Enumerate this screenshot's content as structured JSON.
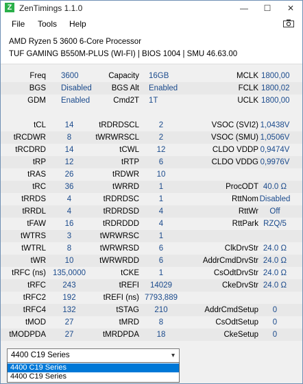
{
  "window": {
    "title": "ZenTimings 1.1.0",
    "icon_letter": "Z",
    "minimize": "—",
    "maximize": "☐",
    "close": "✕"
  },
  "menu": {
    "file": "File",
    "tools": "Tools",
    "help": "Help"
  },
  "header": {
    "cpu": "AMD Ryzen 5 3600 6-Core Processor",
    "board": "TUF GAMING B550M-PLUS (WI-FI) | BIOS 1004 | SMU 46.63.00"
  },
  "top_rows": [
    {
      "l1": "Freq",
      "v1": "3600",
      "l2": "Capacity",
      "v2": "16GB",
      "l3": "MCLK",
      "v3": "1800,00"
    },
    {
      "l1": "BGS",
      "v1": "Disabled",
      "l2": "BGS Alt",
      "v2": "Enabled",
      "l3": "FCLK",
      "v3": "1800,02"
    },
    {
      "l1": "GDM",
      "v1": "Enabled",
      "l2": "Cmd2T",
      "v2": "1T",
      "l3": "UCLK",
      "v3": "1800,00"
    }
  ],
  "rows": [
    {
      "l1": "tCL",
      "v1": "14",
      "l2": "tRDRDSCL",
      "v2": "2",
      "l3": "VSOC (SVI2)",
      "v3": "1,0438V"
    },
    {
      "l1": "tRCDWR",
      "v1": "8",
      "l2": "tWRWRSCL",
      "v2": "2",
      "l3": "VSOC (SMU)",
      "v3": "1,0506V"
    },
    {
      "l1": "tRCDRD",
      "v1": "14",
      "l2": "tCWL",
      "v2": "12",
      "l3": "CLDO VDDP",
      "v3": "0,9474V"
    },
    {
      "l1": "tRP",
      "v1": "12",
      "l2": "tRTP",
      "v2": "6",
      "l3": "CLDO VDDG",
      "v3": "0,9976V"
    },
    {
      "l1": "tRAS",
      "v1": "26",
      "l2": "tRDWR",
      "v2": "10",
      "l3": "",
      "v3": ""
    },
    {
      "l1": "tRC",
      "v1": "36",
      "l2": "tWRRD",
      "v2": "1",
      "l3": "ProcODT",
      "v3": "40.0 Ω"
    },
    {
      "l1": "tRRDS",
      "v1": "4",
      "l2": "tRDRDSC",
      "v2": "1",
      "l3": "RttNom",
      "v3": "Disabled"
    },
    {
      "l1": "tRRDL",
      "v1": "4",
      "l2": "tRDRDSD",
      "v2": "4",
      "l3": "RttWr",
      "v3": "Off"
    },
    {
      "l1": "tFAW",
      "v1": "16",
      "l2": "tRDRDDD",
      "v2": "4",
      "l3": "RttPark",
      "v3": "RZQ/5"
    },
    {
      "l1": "tWTRS",
      "v1": "3",
      "l2": "tWRWRSC",
      "v2": "1",
      "l3": "",
      "v3": ""
    },
    {
      "l1": "tWTRL",
      "v1": "8",
      "l2": "tWRWRSD",
      "v2": "6",
      "l3": "ClkDrvStr",
      "v3": "24.0 Ω"
    },
    {
      "l1": "tWR",
      "v1": "10",
      "l2": "tWRWRDD",
      "v2": "6",
      "l3": "AddrCmdDrvStr",
      "v3": "24.0 Ω"
    },
    {
      "l1": "tRFC (ns)",
      "v1": "135,0000",
      "l2": "tCKE",
      "v2": "1",
      "l3": "CsOdtDrvStr",
      "v3": "24.0 Ω"
    },
    {
      "l1": "tRFC",
      "v1": "243",
      "l2": "tREFI",
      "v2": "14029",
      "l3": "CkeDrvStr",
      "v3": "24.0 Ω"
    },
    {
      "l1": "tRFC2",
      "v1": "192",
      "l2": "tREFI (ns)",
      "v2": "7793,889",
      "l3": "",
      "v3": ""
    },
    {
      "l1": "tRFC4",
      "v1": "132",
      "l2": "tSTAG",
      "v2": "210",
      "l3": "AddrCmdSetup",
      "v3": "0"
    },
    {
      "l1": "tMOD",
      "v1": "27",
      "l2": "tMRD",
      "v2": "8",
      "l3": "CsOdtSetup",
      "v3": "0"
    },
    {
      "l1": "tMODPDA",
      "v1": "27",
      "l2": "tMRDPDA",
      "v2": "18",
      "l3": "CkeSetup",
      "v3": "0"
    }
  ],
  "preset": {
    "selected": "4400 C19 Series",
    "options": [
      "4400 C19 Series",
      "4400 C19 Series"
    ]
  }
}
